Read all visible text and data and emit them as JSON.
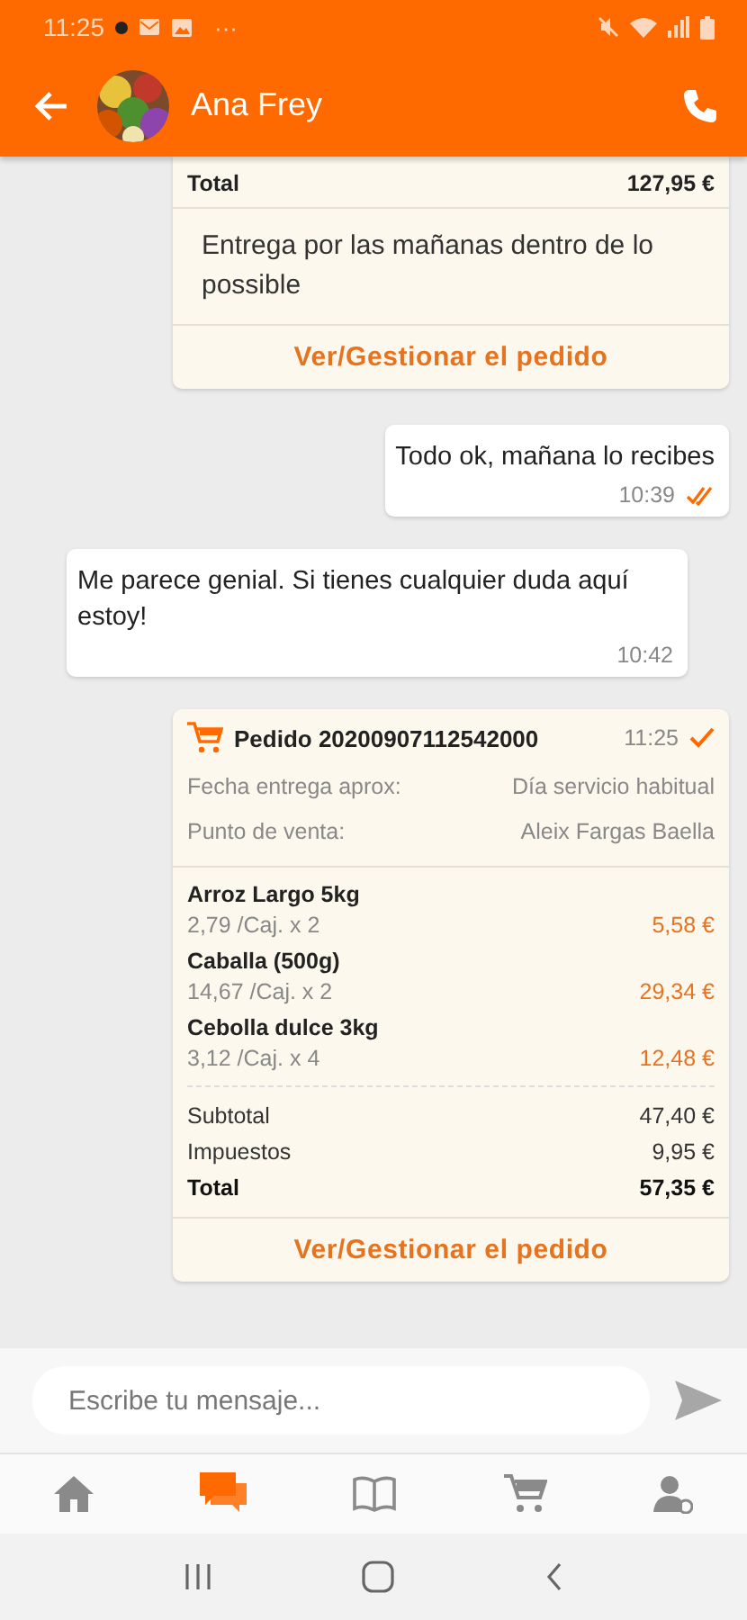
{
  "status_bar": {
    "time": "11:25",
    "more": "···"
  },
  "header": {
    "contact": "Ana Frey"
  },
  "messages": [
    {
      "kind": "order_tail",
      "total_label": "Total",
      "total": "127,95 €",
      "note": "Entrega por las mañanas dentro de lo possible",
      "action": "Ver/Gestionar el pedido"
    },
    {
      "kind": "text",
      "outgoing": true,
      "text": "Todo ok, mañana lo recibes",
      "time": "10:39",
      "read": true
    },
    {
      "kind": "text",
      "outgoing": false,
      "text": "Me parece genial. Si tienes cualquier duda aquí estoy!",
      "time": "10:42"
    },
    {
      "kind": "order",
      "outgoing": true,
      "title": "Pedido 20200907112542000",
      "time": "11:25",
      "read": false,
      "info": [
        {
          "label": "Fecha entrega aprox:",
          "value": "Día servicio habitual"
        },
        {
          "label": "Punto de venta:",
          "value": "Aleix Fargas Baella"
        }
      ],
      "items": [
        {
          "name": "Arroz Largo 5kg",
          "unit": "2,79  /Caj. x 2",
          "price": "5,58 €"
        },
        {
          "name": "Caballa (500g)",
          "unit": "14,67  /Caj. x 2",
          "price": "29,34 €"
        },
        {
          "name": "Cebolla dulce 3kg",
          "unit": "3,12  /Caj. x 4",
          "price": "12,48 €"
        }
      ],
      "totals": [
        {
          "label": "Subtotal",
          "value": "47,40 €",
          "bold": false
        },
        {
          "label": "Impuestos",
          "value": "9,95 €",
          "bold": false
        },
        {
          "label": "Total",
          "value": "57,35 €",
          "bold": true
        }
      ],
      "action": "Ver/Gestionar el pedido"
    }
  ],
  "composer": {
    "placeholder": "Escribe tu mensaje..."
  },
  "nav": [
    {
      "kind": "home",
      "selected": false
    },
    {
      "kind": "chat",
      "selected": true
    },
    {
      "kind": "book",
      "selected": false
    },
    {
      "kind": "cart",
      "selected": false
    },
    {
      "kind": "account",
      "selected": false
    }
  ]
}
